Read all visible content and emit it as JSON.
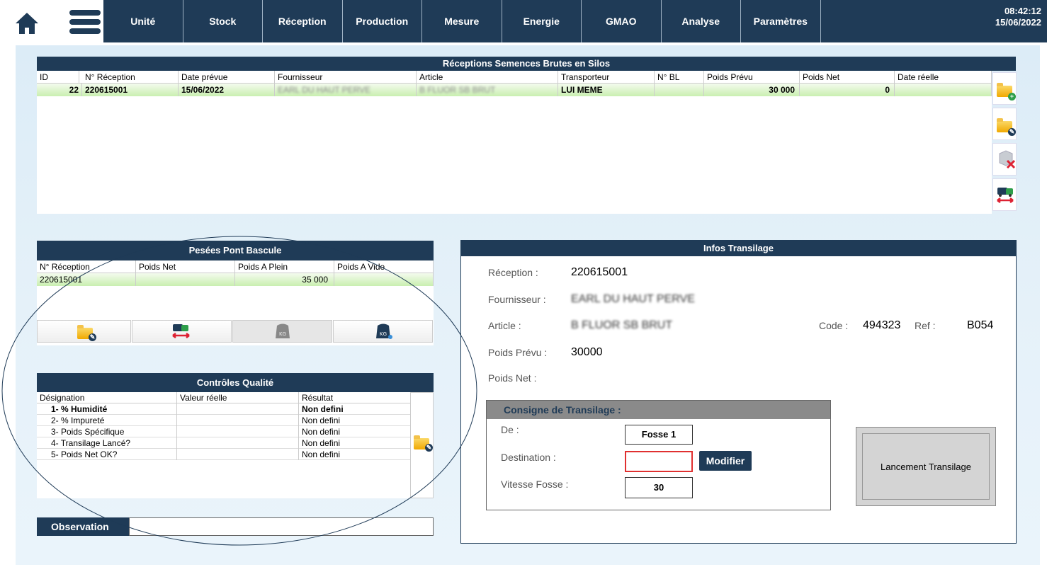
{
  "nav": {
    "items": [
      "Unité",
      "Stock",
      "Réception",
      "Production",
      "Mesure",
      "Energie",
      "GMAO",
      "Analyse",
      "Paramètres"
    ],
    "time": "08:42:12",
    "date": "15/06/2022"
  },
  "receptions": {
    "title": "Réceptions Semences Brutes en Silos",
    "headers": [
      "ID",
      "N° Réception",
      "Date prévue",
      "Fournisseur",
      "Article",
      "Transporteur",
      "N° BL",
      "Poids Prévu",
      "Poids Net",
      "Date réelle"
    ],
    "rows": [
      {
        "id": "22",
        "num": "220615001",
        "date": "15/06/2022",
        "fournisseur": "EARL DU HAUT PERVE",
        "article": "B FLUOR SB BRUT",
        "transporteur": "LUI MEME",
        "bl": "",
        "poids_prevu": "30 000",
        "poids_net": "0",
        "date_reelle": ""
      }
    ]
  },
  "pesees": {
    "title": "Pesées Pont Bascule",
    "headers": [
      "N° Réception",
      "Poids Net",
      "Poids A Plein",
      "Poids A Vide"
    ],
    "rows": [
      {
        "num": "220615001",
        "net": "",
        "plein": "35 000",
        "vide": ""
      }
    ]
  },
  "controles": {
    "title": "Contrôles Qualité",
    "headers": [
      "Désignation",
      "Valeur réelle",
      "Résultat"
    ],
    "rows": [
      {
        "designation": "1- % Humidité",
        "valeur": "",
        "resultat": "Non defini",
        "bold": true
      },
      {
        "designation": "2- % Impureté",
        "valeur": "",
        "resultat": "Non defini",
        "bold": false
      },
      {
        "designation": "3- Poids Spécifique",
        "valeur": "",
        "resultat": "Non defini",
        "bold": false
      },
      {
        "designation": "4- Transilage Lancé?",
        "valeur": "",
        "resultat": "Non defini",
        "bold": false
      },
      {
        "designation": "5- Poids Net OK?",
        "valeur": "",
        "resultat": "Non defini",
        "bold": false
      }
    ]
  },
  "observation": {
    "label": "Observation",
    "value": ""
  },
  "infos": {
    "title": "Infos Transilage",
    "reception_label": "Réception :",
    "reception_value": "220615001",
    "fournisseur_label": "Fournisseur :",
    "fournisseur_value": "EARL DU HAUT PERVE",
    "article_label": "Article :",
    "article_value": "B FLUOR SB BRUT",
    "code_label": "Code :",
    "code_value": "494323",
    "ref_label": "Ref :",
    "ref_value": "B054",
    "poids_prevu_label": "Poids Prévu :",
    "poids_prevu_value": "30000",
    "poids_net_label": "Poids Net :",
    "poids_net_value": ""
  },
  "consigne": {
    "title": "Consigne de Transilage :",
    "de_label": "De :",
    "de_value": "Fosse 1",
    "destination_label": "Destination :",
    "destination_value": "",
    "vitesse_label": "Vitesse Fosse :",
    "vitesse_value": "30",
    "modifier_label": "Modifier"
  },
  "lancement_label": "Lancement Transilage",
  "colors": {
    "navy": "#1f3b57",
    "selection_green": "#c9efb0",
    "destination_border": "#e03030"
  }
}
